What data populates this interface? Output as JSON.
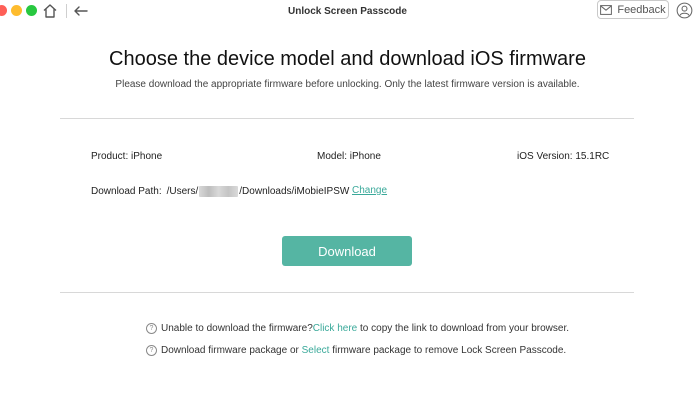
{
  "window": {
    "title": "Unlock Screen Passcode"
  },
  "toolbar": {
    "feedback_label": "Feedback"
  },
  "header": {
    "title": "Choose the device model and download iOS firmware",
    "subtitle": "Please download the appropriate firmware before unlocking. Only the latest firmware version is available."
  },
  "device": {
    "product": "Product: iPhone",
    "model": "Model: iPhone",
    "ios_version": "iOS Version: 15.1RC"
  },
  "download_path": {
    "label": "Download Path:",
    "prefix": "/Users/",
    "suffix": "/Downloads/iMobieIPSW",
    "change_label": "Change"
  },
  "download_button": {
    "label": "Download"
  },
  "help": {
    "line1": {
      "before": "Unable to download the firmware? ",
      "link": "Click here",
      "after": " to copy the link to download from your browser."
    },
    "line2": {
      "before": "Download firmware package or ",
      "link": "Select",
      "after": " firmware package to remove Lock Screen Passcode."
    }
  },
  "colors": {
    "accent": "#55b5a3",
    "link": "#3aa99a"
  }
}
